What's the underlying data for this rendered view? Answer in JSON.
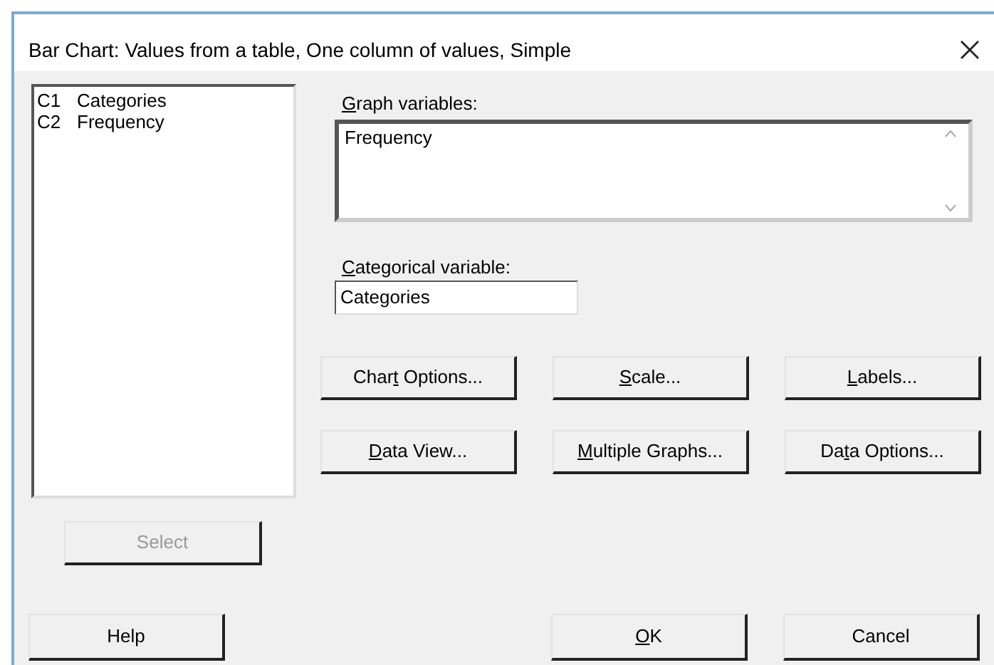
{
  "window": {
    "title": "Bar Chart: Values from a table, One column of values, Simple"
  },
  "variables_list": [
    {
      "column": "C1",
      "name": "Categories"
    },
    {
      "column": "C2",
      "name": "Frequency"
    }
  ],
  "graph_variables": {
    "label": {
      "key": "G",
      "post": "raph variables:"
    },
    "value": "Frequency"
  },
  "categorical_variable": {
    "label": {
      "key": "C",
      "post": "ategorical variable:"
    },
    "value": "Categories"
  },
  "option_buttons": [
    {
      "pre": "Char",
      "key": "t",
      "post": " Options..."
    },
    {
      "key": "S",
      "post": "cale..."
    },
    {
      "key": "L",
      "post": "abels..."
    },
    {
      "key": "D",
      "post": "ata View..."
    },
    {
      "key": "M",
      "post": "ultiple Graphs..."
    },
    {
      "pre": "Da",
      "key": "t",
      "post": "a Options..."
    }
  ],
  "select_button": {
    "label": "Select",
    "disabled": true
  },
  "footer_buttons": [
    {
      "pre": "Help"
    },
    {
      "key": "O",
      "post": "K"
    },
    {
      "pre": "Cancel"
    }
  ]
}
